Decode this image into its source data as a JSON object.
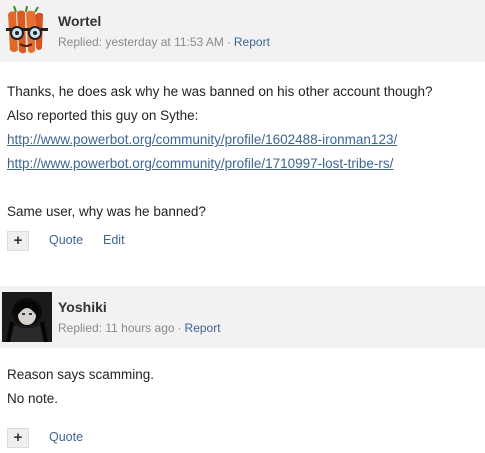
{
  "posts": [
    {
      "author": "Wortel",
      "replied_label": "Replied:",
      "time": "yesterday at 11:53 AM",
      "separator": "·",
      "report_label": "Report",
      "body": {
        "line1": "Thanks, he does ask why he was banned on his other account though?",
        "line2": "Also reported this guy on Sythe:",
        "link1": "http://www.powerbot.org/community/profile/1602488-ironman123/",
        "link2": "http://www.powerbot.org/community/profile/1710997-lost-tribe-rs/",
        "line3": "Same user, why was he banned?"
      },
      "actions": {
        "plus_label": "+",
        "quote_label": "Quote",
        "edit_label": "Edit"
      }
    },
    {
      "author": "Yoshiki",
      "replied_label": "Replied:",
      "time": "11 hours ago",
      "separator": "·",
      "report_label": "Report",
      "body": {
        "line1": "Reason says scamming.",
        "line2": "No note."
      },
      "actions": {
        "plus_label": "+",
        "quote_label": "Quote"
      }
    }
  ],
  "colors": {
    "link": "#3d6594",
    "header_bg": "#f2f2f2",
    "meta_text": "#8a8a8a"
  },
  "icons": {
    "avatar_1": "carrot-character-avatar",
    "avatar_2": "dark-anime-avatar"
  }
}
